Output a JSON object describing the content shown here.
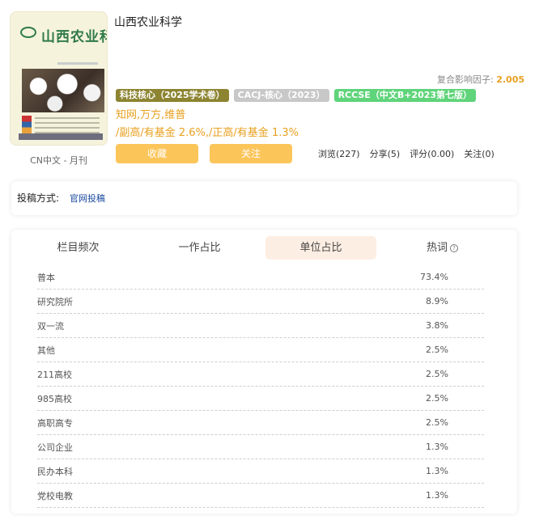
{
  "header": {
    "cover_title": "山西农业科学",
    "journal_title": "山西农业科学",
    "cn_text": "CN中文 - 月刊",
    "impact_label": "复合影响因子: ",
    "impact_value": "2.005",
    "tags": [
      "科技核心（2025学术卷）",
      "CACJ-核心（2023）",
      "RCCSE（中文B+2023第七版）"
    ],
    "databases": "知网,万方,维普",
    "funds": "/副高/有基金 2.6%,/正高/有基金 1.3%",
    "favorite_label": "收藏",
    "follow_label": "关注",
    "stats": [
      "浏览(227)",
      "分享(5)",
      "评分(0.00)",
      "关注(0)"
    ]
  },
  "submission": {
    "label": "投稿方式:",
    "link": "官网投稿"
  },
  "tabs": [
    {
      "label": "栏目频次"
    },
    {
      "label": "一作占比"
    },
    {
      "label": "单位占比"
    },
    {
      "label": "热词"
    }
  ],
  "active_tab": "单位占比",
  "rows": [
    {
      "name": "普本",
      "pct": "73.4%"
    },
    {
      "name": "研究院所",
      "pct": "8.9%"
    },
    {
      "name": "双一流",
      "pct": "3.8%"
    },
    {
      "name": "其他",
      "pct": "2.5%"
    },
    {
      "name": "211高校",
      "pct": "2.5%"
    },
    {
      "name": "985高校",
      "pct": "2.5%"
    },
    {
      "name": "高职高专",
      "pct": "2.5%"
    },
    {
      "name": "公司企业",
      "pct": "1.3%"
    },
    {
      "name": "民办本科",
      "pct": "1.3%"
    },
    {
      "name": "党校电教",
      "pct": "1.3%"
    }
  ]
}
